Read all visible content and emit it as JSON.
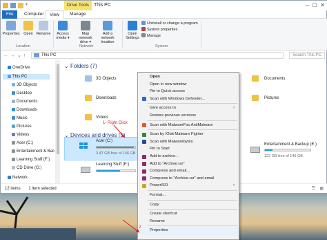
{
  "titlebar": {
    "tools_tab": "Drive Tools",
    "title": "This PC"
  },
  "tabs": [
    "File",
    "Computer",
    "View",
    "Manage"
  ],
  "ribbon": {
    "location": [
      {
        "label": "Properties",
        "icon": "properties-icon"
      },
      {
        "label": "Open",
        "icon": "open-icon"
      },
      {
        "label": "Rename",
        "icon": "rename-icon"
      }
    ],
    "network": [
      {
        "label": "Access media",
        "icon": "media-icon",
        "dropdown": true
      },
      {
        "label": "Map network drive",
        "icon": "map-drive-icon",
        "dropdown": true
      },
      {
        "label": "Add a network location",
        "icon": "network-location-icon"
      }
    ],
    "system_open": {
      "label": "Open Settings",
      "icon": "settings-icon"
    },
    "system_items": [
      "Uninstall or change a program",
      "System properties",
      "Manage"
    ],
    "groups": [
      "Location",
      "Network",
      "System"
    ]
  },
  "address": {
    "path": "This PC",
    "search_placeholder": "Search This PC"
  },
  "nav": [
    "OneDrive",
    "This PC",
    "3D Objects",
    "Desktop",
    "Documents",
    "Downloads",
    "Music",
    "Pictures",
    "Videos",
    "Acer (C:)",
    "Entertainment & Bac",
    "Learning Stuff (F:)",
    "CD Drive (G:)",
    "Network"
  ],
  "folders_header": "Folders (7)",
  "folders": [
    "3D Objects",
    "Downloads",
    "Videos",
    "Documents",
    "Pictures"
  ],
  "drives_header": "Devices and drives (5)",
  "drives": [
    {
      "name": "Acer (C:)",
      "free": "3.47 GB free of 146 GB",
      "used_fraction": 0.97
    },
    {
      "name": "Learning Stuff (F:)",
      "free": "",
      "used_fraction": 0.6
    },
    {
      "name": "Entertainment & Backup (E:)",
      "free": "122 GB free of 146 GB",
      "used_fraction": 0.16
    }
  ],
  "status": {
    "items": "12 items",
    "selected": "1 item selected"
  },
  "annotations": {
    "right_click": "1- Right Click",
    "step2": "2"
  },
  "menu": [
    {
      "label": "Open",
      "bold": true
    },
    {
      "label": "Open in new window"
    },
    {
      "label": "Pin to Quick access"
    },
    {
      "label": "Scan with Windows Defender...",
      "icon": "defender-icon",
      "color": "#1f6fcf"
    },
    {
      "sep": true
    },
    {
      "label": "Give access to",
      "submenu": true
    },
    {
      "label": "Restore previous versions"
    },
    {
      "sep": true
    },
    {
      "label": "Scan with MalwareFox AntiMalware",
      "icon": "malwarefox-icon",
      "color": "#e05a2b"
    },
    {
      "sep": true
    },
    {
      "label": "Scan by IObit Malware Fighter",
      "icon": "iobit-icon",
      "color": "#2a8a3a"
    },
    {
      "label": "Scan with Malwarebytes",
      "icon": "malwarebytes-icon",
      "color": "#1b4fa0"
    },
    {
      "label": "Pin to Start"
    },
    {
      "label": "Add to archive...",
      "icon": "winrar-icon",
      "color": "#8a2b6e"
    },
    {
      "label": "Add to \"Archive.rar\"",
      "icon": "winrar-icon",
      "color": "#8a2b6e"
    },
    {
      "label": "Compress and email...",
      "icon": "winrar-icon",
      "color": "#8a2b6e"
    },
    {
      "label": "Compress to \"Archive.rar\" and email",
      "icon": "winrar-icon",
      "color": "#8a2b6e"
    },
    {
      "label": "PowerISO",
      "icon": "poweriso-icon",
      "color": "#d9a21b",
      "submenu": true
    },
    {
      "sep": true
    },
    {
      "label": "Format..."
    },
    {
      "sep": true
    },
    {
      "label": "Copy"
    },
    {
      "sep": true
    },
    {
      "label": "Create shortcut"
    },
    {
      "label": "Rename"
    },
    {
      "sep": true
    },
    {
      "label": "Properties",
      "highlight": true
    }
  ]
}
